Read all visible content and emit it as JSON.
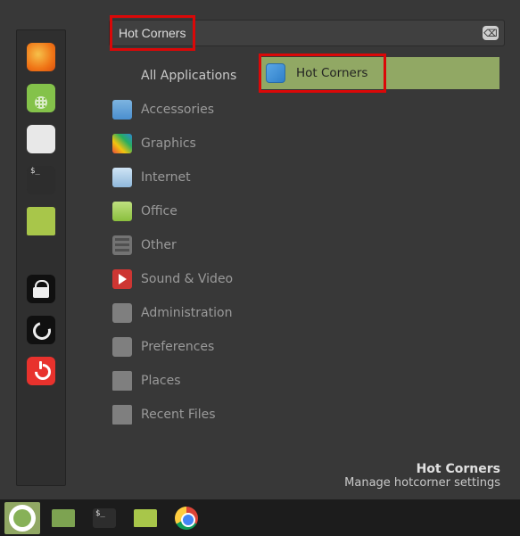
{
  "search": {
    "value": "Hot Corners"
  },
  "clear_glyph": "⌫",
  "categories": [
    {
      "label": "All Applications",
      "icon": ""
    },
    {
      "label": "Accessories",
      "icon": "c-access"
    },
    {
      "label": "Graphics",
      "icon": "c-graphics"
    },
    {
      "label": "Internet",
      "icon": "c-internet"
    },
    {
      "label": "Office",
      "icon": "c-office"
    },
    {
      "label": "Other",
      "icon": "c-other"
    },
    {
      "label": "Sound & Video",
      "icon": "c-sv"
    },
    {
      "label": "Administration",
      "icon": "c-admin"
    },
    {
      "label": "Preferences",
      "icon": "c-pref"
    },
    {
      "label": "Places",
      "icon": "c-places"
    },
    {
      "label": "Recent Files",
      "icon": "c-recent"
    }
  ],
  "results": [
    {
      "label": "Hot Corners"
    }
  ],
  "footer": {
    "title": "Hot Corners",
    "desc": "Manage hotcorner settings"
  }
}
